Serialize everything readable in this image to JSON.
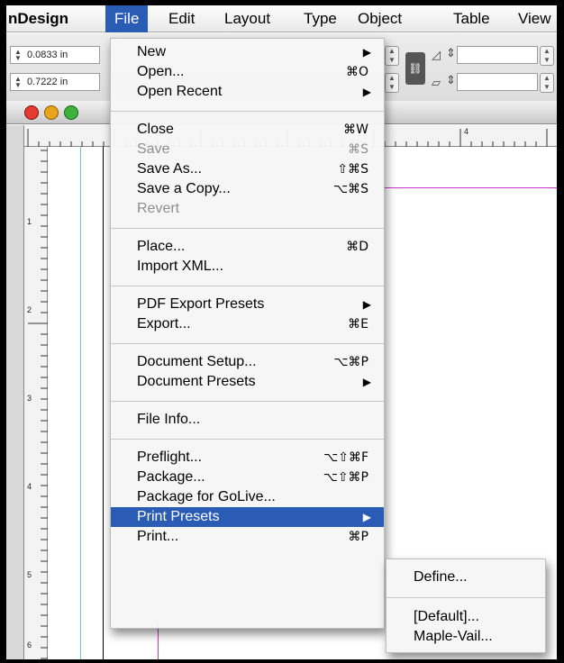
{
  "menubar": {
    "items": [
      "nDesign",
      "File",
      "Edit",
      "Layout",
      "Type",
      "Object",
      "Table",
      "View"
    ],
    "active": "File"
  },
  "controlbar": {
    "field1": "0.0833 in",
    "field2": "0.7222 in"
  },
  "ruler": {
    "h_label": "4",
    "v_labels": [
      "1",
      "2",
      "3",
      "4",
      "5",
      "6"
    ]
  },
  "file_menu": {
    "new": {
      "label": "New"
    },
    "open": {
      "label": "Open...",
      "shortcut": "⌘O"
    },
    "open_recent": {
      "label": "Open Recent"
    },
    "close": {
      "label": "Close",
      "shortcut": "⌘W"
    },
    "save": {
      "label": "Save",
      "shortcut": "⌘S"
    },
    "save_as": {
      "label": "Save As...",
      "shortcut": "⇧⌘S"
    },
    "save_copy": {
      "label": "Save a Copy...",
      "shortcut": "⌥⌘S"
    },
    "revert": {
      "label": "Revert"
    },
    "place": {
      "label": "Place...",
      "shortcut": "⌘D"
    },
    "import_xml": {
      "label": "Import XML..."
    },
    "pdf_presets": {
      "label": "PDF Export Presets"
    },
    "export": {
      "label": "Export...",
      "shortcut": "⌘E"
    },
    "doc_setup": {
      "label": "Document Setup...",
      "shortcut": "⌥⌘P"
    },
    "doc_presets": {
      "label": "Document Presets"
    },
    "file_info": {
      "label": "File Info..."
    },
    "preflight": {
      "label": "Preflight...",
      "shortcut": "⌥⇧⌘F"
    },
    "package": {
      "label": "Package...",
      "shortcut": "⌥⇧⌘P"
    },
    "package_golive": {
      "label": "Package for GoLive..."
    },
    "print_presets": {
      "label": "Print Presets"
    },
    "print": {
      "label": "Print...",
      "shortcut": "⌘P"
    }
  },
  "submenu": {
    "define": "Define...",
    "default": "[Default]...",
    "maple_vail": "Maple-Vail..."
  },
  "colors": {
    "highlight": "#2a5bb5",
    "guide_magenta": "#cc33cc",
    "guide_cyan": "#66cccc"
  }
}
